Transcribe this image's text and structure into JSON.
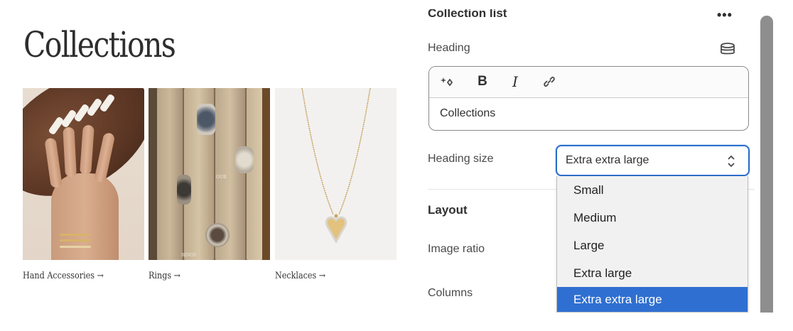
{
  "preview": {
    "title": "Collections",
    "cards": [
      {
        "label": "Hand Accessories",
        "arrow": "→"
      },
      {
        "label": "Rings",
        "arrow": "→",
        "image_text": [
          "OUR",
          "RINGS"
        ]
      },
      {
        "label": "Necklaces",
        "arrow": "→"
      }
    ]
  },
  "panel": {
    "section_title": "Collection list",
    "more_icon": "•••",
    "heading_label": "Heading",
    "heading_icon": "database-icon",
    "editor": {
      "tools": [
        "magic-icon",
        "bold-icon",
        "italic-icon",
        "link-icon"
      ],
      "bold_glyph": "B",
      "italic_glyph": "I",
      "content": "Collections"
    },
    "heading_size": {
      "label": "Heading size",
      "value": "Extra extra large",
      "options": [
        "Small",
        "Medium",
        "Large",
        "Extra large",
        "Extra extra large"
      ],
      "selected_index": 4
    },
    "layout_title": "Layout",
    "image_ratio_label": "Image ratio",
    "columns_label": "Columns"
  },
  "colors": {
    "accent": "#2c6ecb",
    "selected_option": "#2f6fd1",
    "scrollbar": "#8e8e8e"
  }
}
